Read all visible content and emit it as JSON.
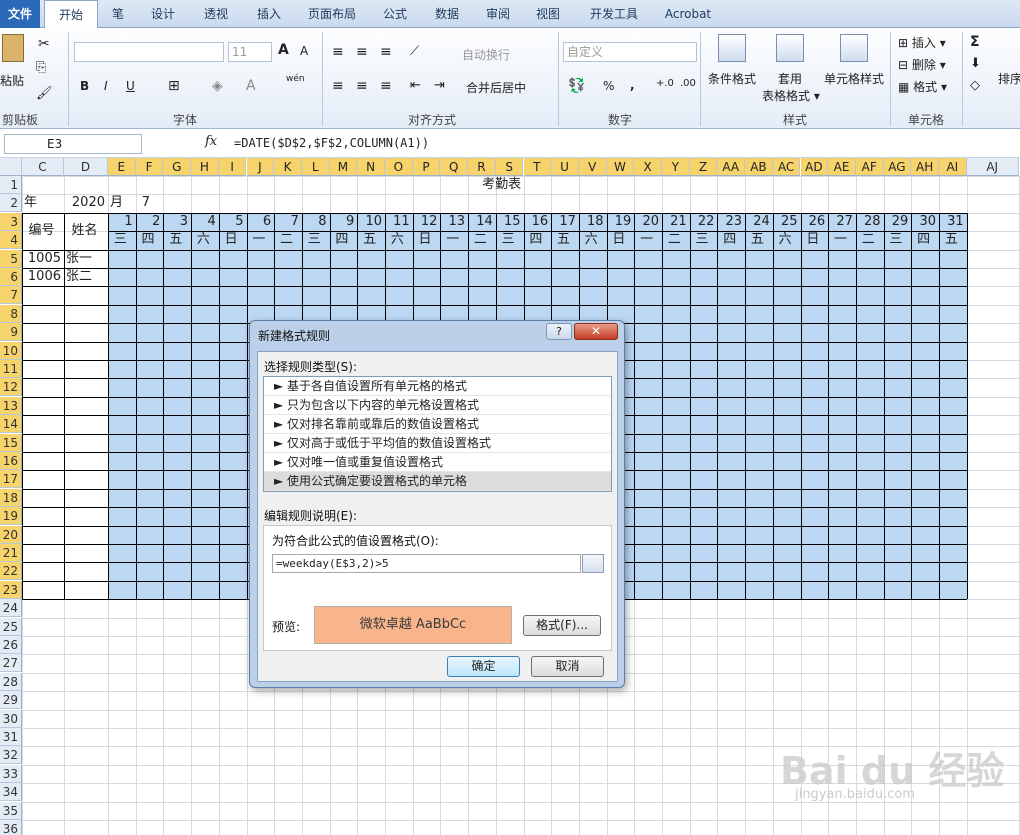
{
  "tabs": [
    "文件",
    "开始",
    "笔",
    "设计",
    "透视",
    "插入",
    "页面布局",
    "公式",
    "数据",
    "审阅",
    "视图",
    "开发工具",
    "Acrobat"
  ],
  "ribbon": {
    "clipboard": {
      "paste": "粘贴",
      "group": "剪贴板"
    },
    "font": {
      "name": "",
      "size": "11",
      "group": "字体",
      "grow": "A",
      "shrink": "A",
      "bold": "B",
      "italic": "I",
      "underline": "U",
      "wen": "wén"
    },
    "align": {
      "wrap": "自动换行",
      "merge": "合并后居中",
      "group": "对齐方式"
    },
    "number": {
      "format": "自定义",
      "percent": "%",
      "comma": ",",
      "group": "数字"
    },
    "styles": {
      "cond": "条件格式",
      "table": "套用\n表格格式",
      "cell": "单元格样式",
      "group": "样式"
    },
    "cells": {
      "insert": "插入",
      "delete": "删除",
      "format": "格式",
      "group": "单元格"
    },
    "edit": {
      "sigma": "Σ",
      "sort": "排序"
    }
  },
  "formula_bar": {
    "name_box": "E3",
    "fx": "fx",
    "formula": "=DATE($D$2,$F$2,COLUMN(A1))"
  },
  "sheet": {
    "columns": [
      "C",
      "D",
      "E",
      "F",
      "G",
      "H",
      "I",
      "J",
      "K",
      "L",
      "M",
      "N",
      "O",
      "P",
      "Q",
      "R",
      "S",
      "T",
      "U",
      "V",
      "W",
      "X",
      "Y",
      "Z",
      "AA",
      "AB",
      "AC",
      "AD",
      "AE",
      "AF",
      "AG",
      "AH",
      "AI",
      "AJ"
    ],
    "rows": [
      "1",
      "2",
      "3",
      "4",
      "5",
      "6",
      "7",
      "8",
      "9",
      "10",
      "11",
      "12",
      "13",
      "14",
      "15",
      "16",
      "17",
      "18",
      "19",
      "20",
      "21",
      "22",
      "23",
      "24",
      "25",
      "26",
      "27",
      "28",
      "29",
      "30",
      "31",
      "32",
      "33",
      "34",
      "35",
      "36"
    ],
    "title": "考勤表",
    "year_label": "年",
    "year": "2020",
    "month_label": "月",
    "month": "7",
    "id_header": "编号",
    "name_header": "姓名",
    "employees": [
      {
        "id": "1005",
        "name": "张一"
      },
      {
        "id": "1006",
        "name": "张二"
      }
    ],
    "days": [
      "1",
      "2",
      "3",
      "4",
      "5",
      "6",
      "7",
      "8",
      "9",
      "10",
      "11",
      "12",
      "13",
      "14",
      "15",
      "16",
      "17",
      "18",
      "19",
      "20",
      "21",
      "22",
      "23",
      "24",
      "25",
      "26",
      "27",
      "28",
      "29",
      "30",
      "31"
    ],
    "weekdays": [
      "三",
      "四",
      "五",
      "六",
      "日",
      "一",
      "二",
      "三",
      "四",
      "五",
      "六",
      "日",
      "一",
      "二",
      "三",
      "四",
      "五",
      "六",
      "日",
      "一",
      "二",
      "三",
      "四",
      "五",
      "六",
      "日",
      "一",
      "二",
      "三",
      "四",
      "五"
    ]
  },
  "dialog": {
    "title": "新建格式规则",
    "help": "?",
    "close": "✕",
    "select_type_label": "选择规则类型(S):",
    "rule_types": [
      "► 基于各自值设置所有单元格的格式",
      "► 只为包含以下内容的单元格设置格式",
      "► 仅对排名靠前或靠后的数值设置格式",
      "► 仅对高于或低于平均值的数值设置格式",
      "► 仅对唯一值或重复值设置格式",
      "► 使用公式确定要设置格式的单元格"
    ],
    "edit_desc_label": "编辑规则说明(E):",
    "formula_label": "为符合此公式的值设置格式(O):",
    "formula_value": "=weekday(E$3,2)>5",
    "preview_label": "预览:",
    "preview_text": "微软卓越  AaBbCc",
    "preview_color": "#f8b48a",
    "format_button": "格式(F)...",
    "ok_button": "确定",
    "cancel_button": "取消"
  },
  "watermark": {
    "text": "Bai du 经验",
    "sub": "jingyan.baidu.com"
  }
}
